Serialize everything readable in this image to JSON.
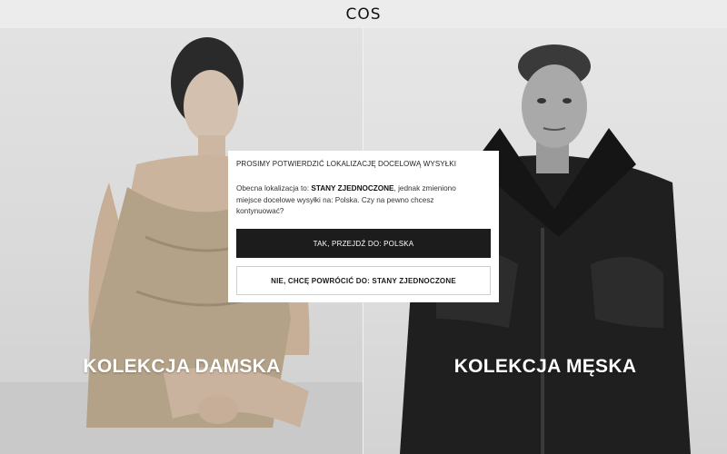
{
  "header": {
    "logo": "COS"
  },
  "collections": {
    "women_label": "KOLEKCJA DAMSKA",
    "men_label": "KOLEKCJA MĘSKA"
  },
  "modal": {
    "title": "PROSIMY POTWIERDZIĆ LOKALIZACJĘ DOCELOWĄ WYSYŁKI",
    "text_prefix": "Obecna lokalizacja to: ",
    "current_location": "STANY ZJEDNOCZONE",
    "text_suffix": ", jednak zmieniono miejsce docelowe wysyłki na: Polska. Czy na pewno chcesz kontynuować?",
    "confirm_label": "TAK, PRZEJDŹ DO: POLSKA",
    "decline_label": "NIE, CHCĘ POWRÓCIĆ DO: STANY ZJEDNOCZONE"
  },
  "colors": {
    "button_dark": "#1c1c1c",
    "background": "#ececec"
  }
}
